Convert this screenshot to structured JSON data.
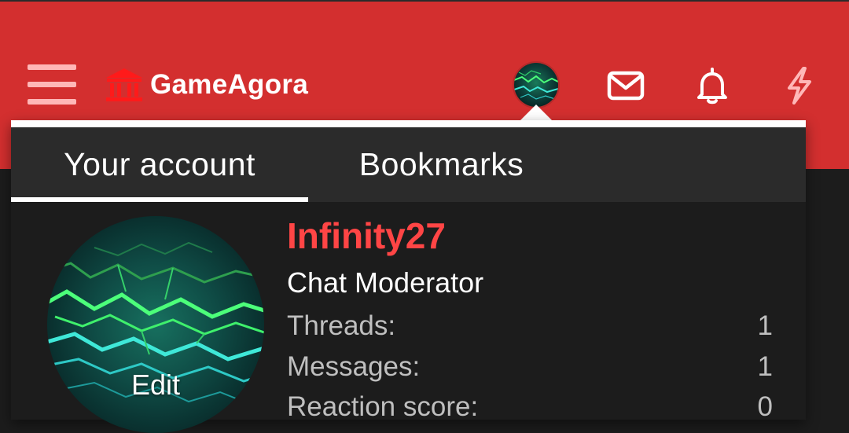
{
  "header": {
    "site_name": "GameAgora",
    "icons": [
      "menu-icon",
      "bank-icon",
      "mail-icon",
      "bell-icon",
      "lightning-icon"
    ]
  },
  "account_menu": {
    "tabs": [
      {
        "label": "Your account",
        "active": true
      },
      {
        "label": "Bookmarks",
        "active": false
      }
    ],
    "user": {
      "name": "Infinity27",
      "title": "Chat Moderator",
      "avatar_action": "Edit"
    },
    "stats": [
      {
        "label": "Threads:",
        "value": "1"
      },
      {
        "label": "Messages:",
        "value": "1"
      },
      {
        "label": "Reaction score:",
        "value": "0"
      }
    ]
  },
  "colors": {
    "header_red": "#d32f2f",
    "username_red": "#ff4545",
    "panel_dark": "#1c1c1c",
    "tab_bar": "#2b2b2b"
  }
}
